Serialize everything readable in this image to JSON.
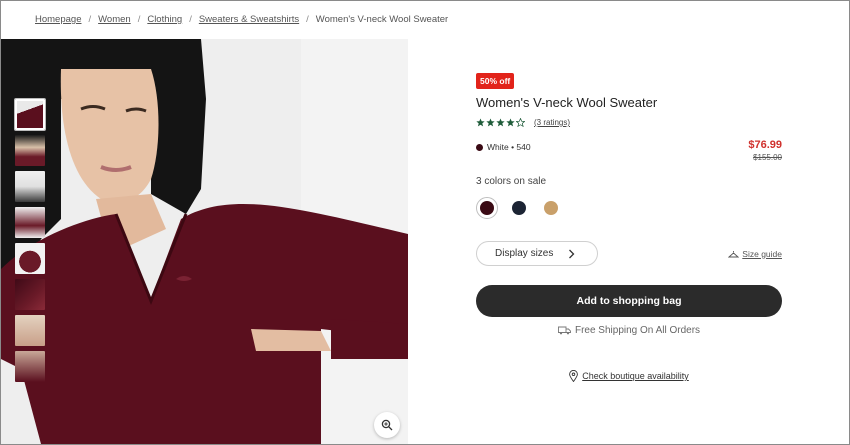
{
  "breadcrumb": {
    "items": [
      "Homepage",
      "Women",
      "Clothing",
      "Sweaters & Sweatshirts"
    ],
    "current": "Women's V-neck Wool Sweater",
    "separator": "/"
  },
  "product": {
    "badge": "50% off",
    "title": "Women's V-neck Wool Sweater",
    "rating": {
      "value": 4,
      "max": 5,
      "count_label": "(3 ratings)"
    },
    "current_color": "White • 540",
    "price_sale": "$76.99",
    "price_original": "$155.00",
    "colors_label": "3 colors on sale",
    "swatches": [
      {
        "name": "burgundy",
        "color": "#3a0a14",
        "selected": true
      },
      {
        "name": "navy",
        "color": "#1c2434",
        "selected": false
      },
      {
        "name": "camel",
        "color": "#c9a06a",
        "selected": false
      }
    ],
    "size_button": "Display sizes",
    "size_guide": "Size guide",
    "add_to_bag": "Add to shopping bag",
    "shipping": "Free Shipping On All Orders",
    "boutique": "Check boutique availability"
  },
  "colors": {
    "accent_red": "#e2231a",
    "star_green": "#1f5c3a",
    "button_dark": "#2b2b2b"
  },
  "icons": [
    "star-icon",
    "chevron-right-icon",
    "hanger-icon",
    "truck-icon",
    "location-pin-icon",
    "zoom-icon"
  ]
}
